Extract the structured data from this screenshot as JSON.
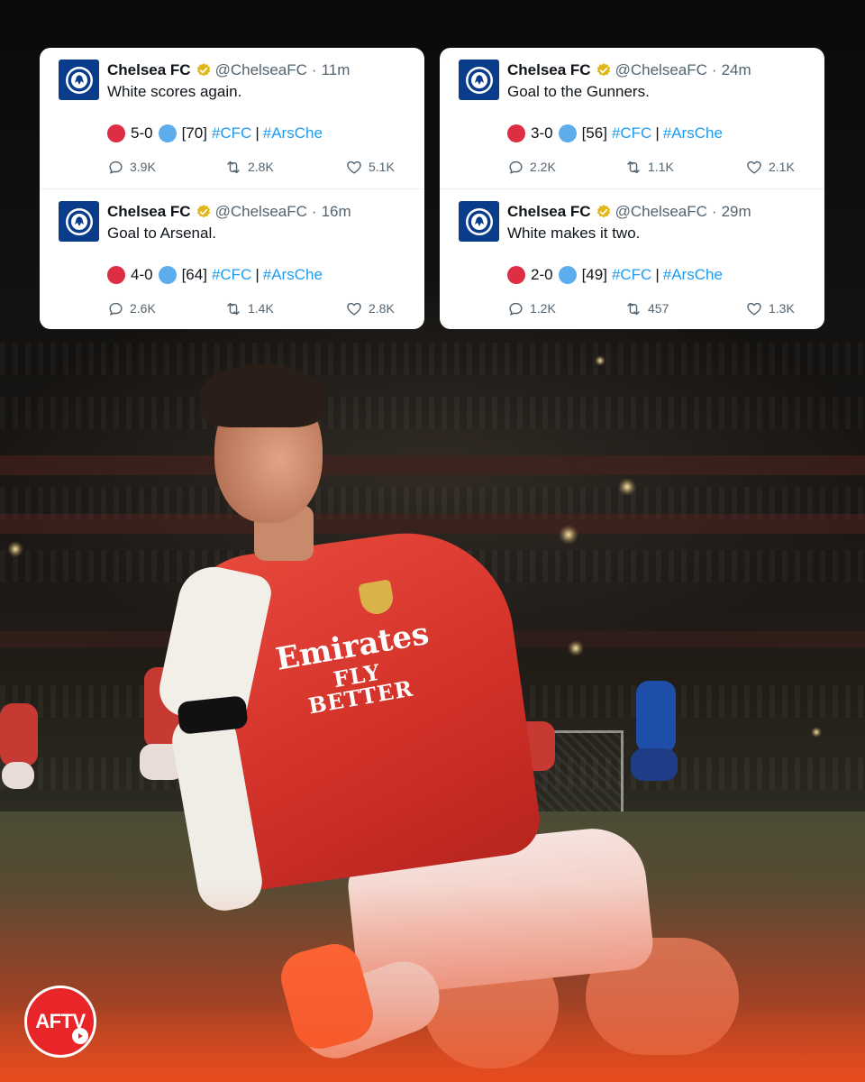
{
  "brand_colors": {
    "arsenal_red": "#e8262a",
    "chelsea_blue": "#0a3c8c",
    "link_blue": "#1d9bf0",
    "muted_text": "#536471"
  },
  "logo": {
    "text": "AFTV",
    "icon": "play-icon"
  },
  "tweets": [
    {
      "name": "Chelsea FC",
      "handle": "@ChelseaFC",
      "separator": "·",
      "time": "11m",
      "text": "White scores again.",
      "score": "5-0",
      "minute": "[70]",
      "tag1": "#CFC",
      "divider": "|",
      "tag2": "#ArsChe",
      "replies": "3.9K",
      "retweets": "2.8K",
      "likes": "5.1K"
    },
    {
      "name": "Chelsea FC",
      "handle": "@ChelseaFC",
      "separator": "·",
      "time": "16m",
      "text": "Goal to Arsenal.",
      "score": "4-0",
      "minute": "[64]",
      "tag1": "#CFC",
      "divider": "|",
      "tag2": "#ArsChe",
      "replies": "2.6K",
      "retweets": "1.4K",
      "likes": "2.8K"
    },
    {
      "name": "Chelsea FC",
      "handle": "@ChelseaFC",
      "separator": "·",
      "time": "24m",
      "text": "Goal to the Gunners.",
      "score": "3-0",
      "minute": "[56]",
      "tag1": "#CFC",
      "divider": "|",
      "tag2": "#ArsChe",
      "replies": "2.2K",
      "retweets": "1.1K",
      "likes": "2.1K"
    },
    {
      "name": "Chelsea FC",
      "handle": "@ChelseaFC",
      "separator": "·",
      "time": "29m",
      "text": "White makes it two.",
      "score": "2-0",
      "minute": "[49]",
      "tag1": "#CFC",
      "divider": "|",
      "tag2": "#ArsChe",
      "replies": "1.2K",
      "retweets": "457",
      "likes": "1.3K"
    }
  ],
  "photo": {
    "sponsor_line1": "Emirates",
    "sponsor_line2": "FLY BETTER"
  }
}
